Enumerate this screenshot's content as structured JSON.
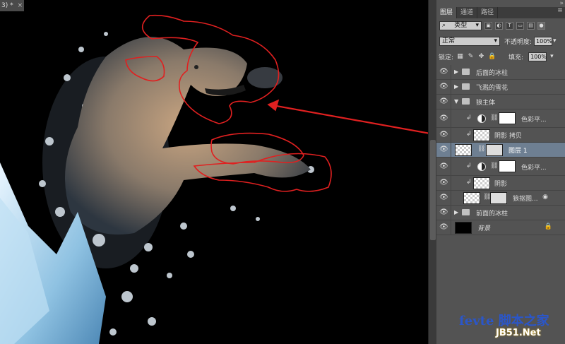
{
  "document": {
    "tab_label": "3) *",
    "close_glyph": "×"
  },
  "panel": {
    "collapse_glyph": "»",
    "tabs": [
      {
        "label": "图层"
      },
      {
        "label": "通道"
      },
      {
        "label": "路径"
      }
    ],
    "menu_glyph": "≡",
    "filter": {
      "kind_label": "类型",
      "icons": [
        "image-filter-icon",
        "adjustment-filter-icon",
        "text-filter-icon",
        "shape-filter-icon",
        "smart-filter-icon"
      ]
    },
    "blend_mode": "正常",
    "opacity_label": "不透明度:",
    "opacity_value": "100%",
    "lock_label": "锁定:",
    "fill_label": "填充:",
    "fill_value": "100%",
    "layers": [
      {
        "name": "后面的冰柱",
        "type": "group"
      },
      {
        "name": "飞溅的雪花",
        "type": "group"
      },
      {
        "name": "狼主体",
        "type": "group-open"
      },
      {
        "name": "色彩平...",
        "type": "adjustment"
      },
      {
        "name": "阴影 拷贝",
        "type": "clip"
      },
      {
        "name": "图层 1",
        "type": "selected"
      },
      {
        "name": "色彩平...",
        "type": "adjustment"
      },
      {
        "name": "阴影",
        "type": "clip"
      },
      {
        "name": "狼抠图...",
        "type": "smart"
      },
      {
        "name": "前面的冰柱",
        "type": "group"
      },
      {
        "name": "背景",
        "type": "background"
      }
    ]
  },
  "watermark": {
    "line1": "fevte 脚本之家",
    "line2": "JB51.Net"
  },
  "colors": {
    "annotation_red": "#e02020",
    "panel_bg": "#535353",
    "selected_layer": "#6e7f92",
    "watermark_blue": "#2b56c8"
  }
}
